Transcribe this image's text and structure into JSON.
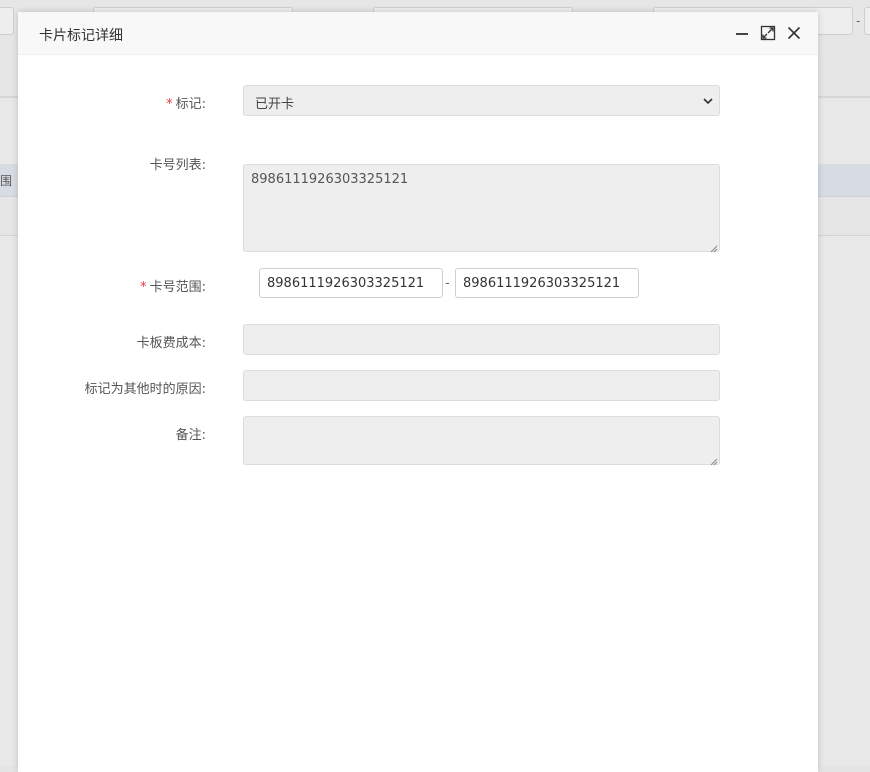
{
  "background": {
    "table_header_text": "围",
    "range_separator": "-"
  },
  "modal": {
    "title": "卡片标记详细",
    "icons": {
      "minimize": "minimize-icon",
      "maximize": "maximize-icon",
      "close": "close-icon"
    }
  },
  "form": {
    "mark": {
      "required_star": "*",
      "label": "标记:",
      "selected": "已开卡"
    },
    "card_list": {
      "label": "卡号列表:",
      "value": "8986111926303325121"
    },
    "card_range": {
      "required_star": "*",
      "label": "卡号范围:",
      "from": "8986111926303325121",
      "separator": "-",
      "to": "8986111926303325121"
    },
    "card_cost": {
      "label": "卡板费成本:",
      "value": ""
    },
    "other_reason": {
      "label": "标记为其他时的原因:",
      "value": ""
    },
    "remarks": {
      "label": "备注:",
      "value": ""
    }
  },
  "colors": {
    "required": "#e4393c",
    "field_bg": "#eeeeee",
    "header_bg": "#f8f8f8"
  }
}
